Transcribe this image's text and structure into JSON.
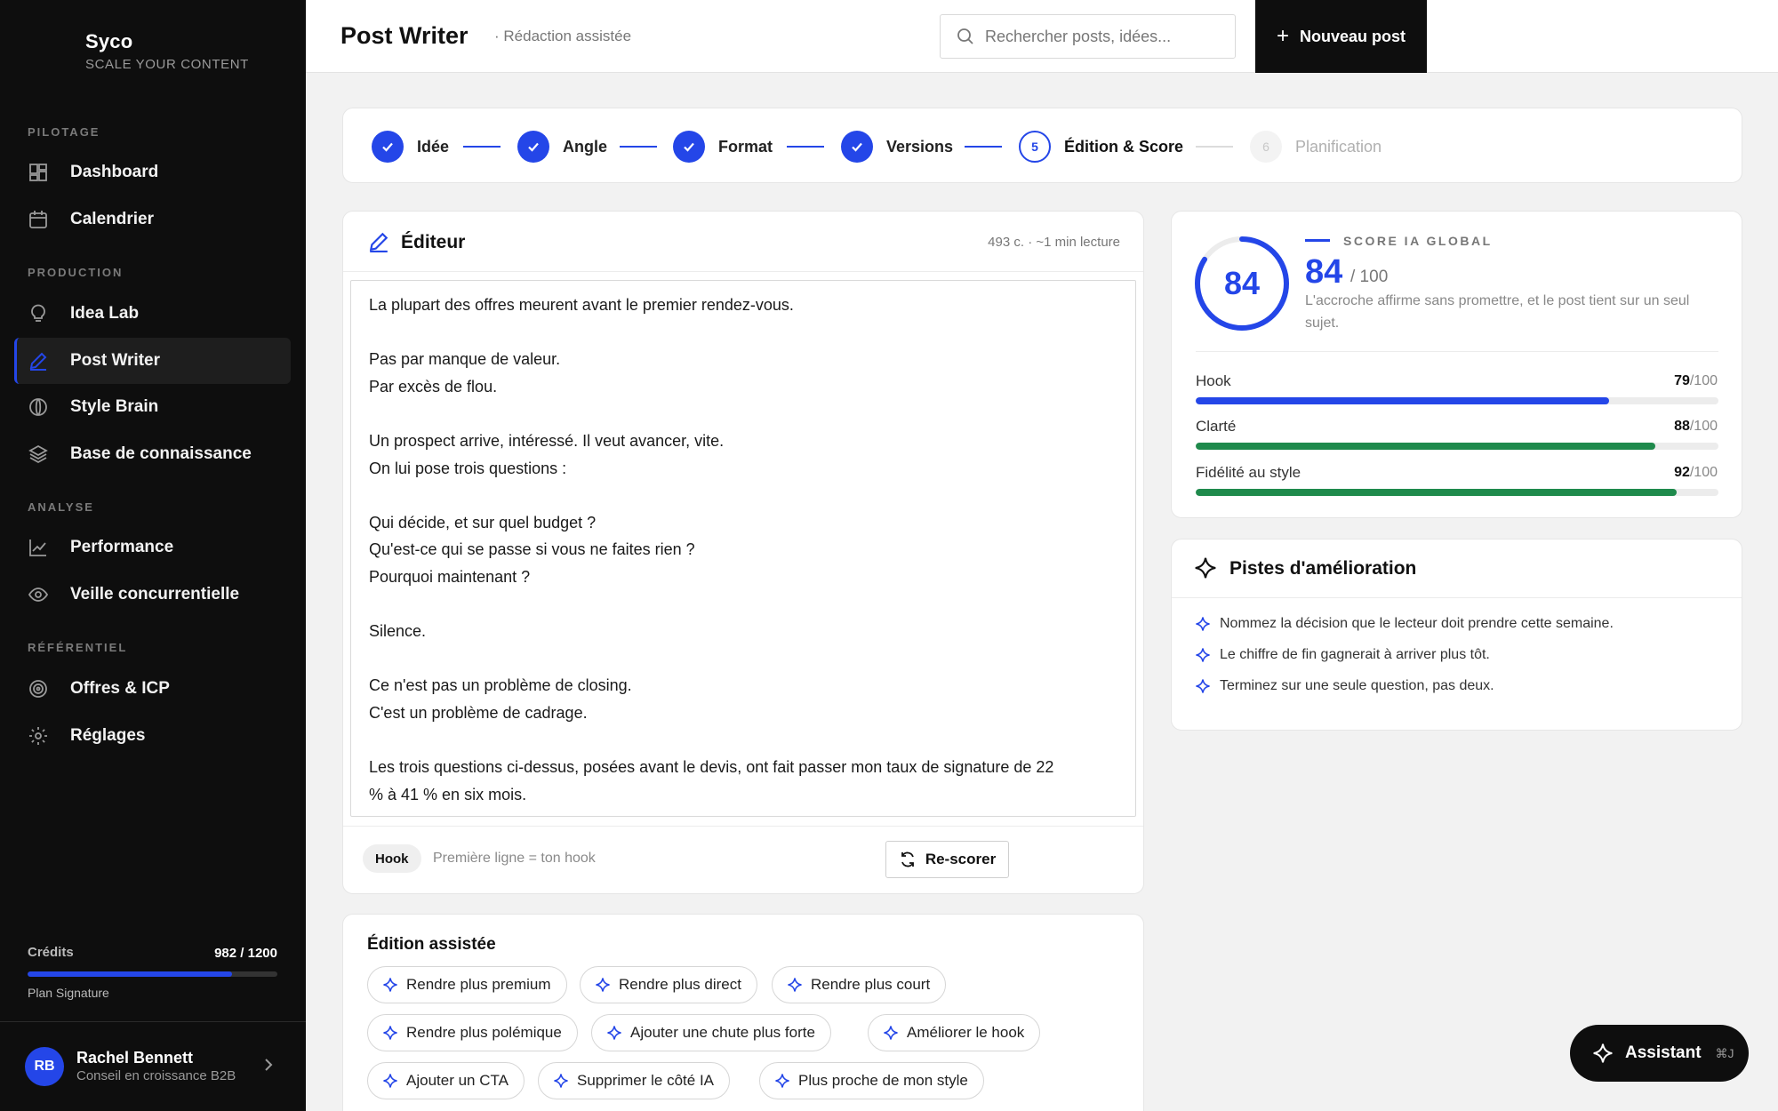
{
  "brand": {
    "name": "Syco",
    "tagline": "SCALE YOUR CONTENT"
  },
  "sidebar": {
    "sections": [
      {
        "label": "PILOTAGE"
      },
      {
        "label": "PRODUCTION"
      },
      {
        "label": "ANALYSE"
      },
      {
        "label": "RÉFÉRENTIEL"
      }
    ],
    "items": [
      {
        "label": "Dashboard",
        "icon": "dashboard-icon"
      },
      {
        "label": "Calendrier",
        "icon": "calendar-icon"
      },
      {
        "label": "Idea Lab",
        "icon": "lightbulb-icon"
      },
      {
        "label": "Post Writer",
        "icon": "pen-icon",
        "active": true
      },
      {
        "label": "Style Brain",
        "icon": "brain-icon"
      },
      {
        "label": "Base de connaissance",
        "icon": "layers-icon"
      },
      {
        "label": "Performance",
        "icon": "chart-line-icon"
      },
      {
        "label": "Veille concurrentielle",
        "icon": "eye-icon"
      },
      {
        "label": "Offres & ICP",
        "icon": "target-icon"
      },
      {
        "label": "Réglages",
        "icon": "gear-icon"
      }
    ],
    "credits": {
      "label": "Crédits",
      "value": "982 / 1200",
      "used": 982,
      "total": 1200
    },
    "plan": "Plan Signature",
    "user": {
      "initials": "RB",
      "name": "Rachel Bennett",
      "role": "Conseil en croissance B2B"
    }
  },
  "header": {
    "title": "Post Writer",
    "subtitle": "· Rédaction assistée",
    "search_placeholder": "Rechercher posts, idées...",
    "new_post_label": "Nouveau post"
  },
  "stepper": {
    "steps": [
      {
        "label": "Idée",
        "state": "done"
      },
      {
        "label": "Angle",
        "state": "done"
      },
      {
        "label": "Format",
        "state": "done"
      },
      {
        "label": "Versions",
        "state": "done"
      },
      {
        "number": "5",
        "label": "Édition & Score",
        "state": "current"
      },
      {
        "number": "6",
        "label": "Planification",
        "state": "pending"
      }
    ]
  },
  "editor": {
    "title": "Éditeur",
    "meta": "493 c. · ~1 min lecture",
    "lines": [
      "La plupart des offres meurent avant le premier rendez-vous.",
      "",
      "Pas par manque de valeur.",
      "Par excès de flou.",
      "",
      "Un prospect arrive, intéressé. Il veut avancer, vite.",
      "On lui pose trois questions :",
      "",
      "Qui décide, et sur quel budget ?",
      "Qu'est-ce qui se passe si vous ne faites rien ?",
      "Pourquoi maintenant ?",
      "",
      "Silence.",
      "",
      "Ce n'est pas un problème de closing.",
      "C'est un problème de cadrage.",
      "",
      "Les trois questions ci-dessus, posées avant le devis, ont fait passer mon taux de signature de 22",
      "% à 41 % en six mois."
    ],
    "hook_tag": "Hook",
    "hook_hint": "Première ligne = ton hook",
    "rescore_label": "Re-scorer"
  },
  "assist": {
    "title": "Édition assistée",
    "chips": [
      "Rendre plus premium",
      "Rendre plus direct",
      "Rendre plus court",
      "Rendre plus polémique",
      "Ajouter une chute plus forte",
      "Améliorer le hook",
      "Ajouter un CTA",
      "Supprimer le côté IA",
      "Plus proche de mon style"
    ]
  },
  "score": {
    "label": "SCORE IA GLOBAL",
    "value": "84",
    "max": "/ 100",
    "percent": 84,
    "description": "L'accroche affirme sans promettre, et le post tient sur un seul sujet.",
    "metrics": [
      {
        "name": "Hook",
        "value": "79",
        "max": "/100",
        "percent": 79,
        "color": "#2446e8"
      },
      {
        "name": "Clarté",
        "value": "88",
        "max": "/100",
        "percent": 88,
        "color": "#1f8a4c"
      },
      {
        "name": "Fidélité au style",
        "value": "92",
        "max": "/100",
        "percent": 92,
        "color": "#1f8a4c"
      }
    ]
  },
  "improvements": {
    "title": "Pistes d'amélioration",
    "items": [
      "Nommez la décision que le lecteur doit prendre cette semaine.",
      "Le chiffre de fin gagnerait à arriver plus tôt.",
      "Terminez sur une seule question, pas deux."
    ]
  },
  "assistant": {
    "label": "Assistant",
    "shortcut": "⌘J"
  },
  "colors": {
    "accent": "#2446e8",
    "success": "#1f8a4c",
    "sidebar_bg": "#0e0e0e"
  }
}
